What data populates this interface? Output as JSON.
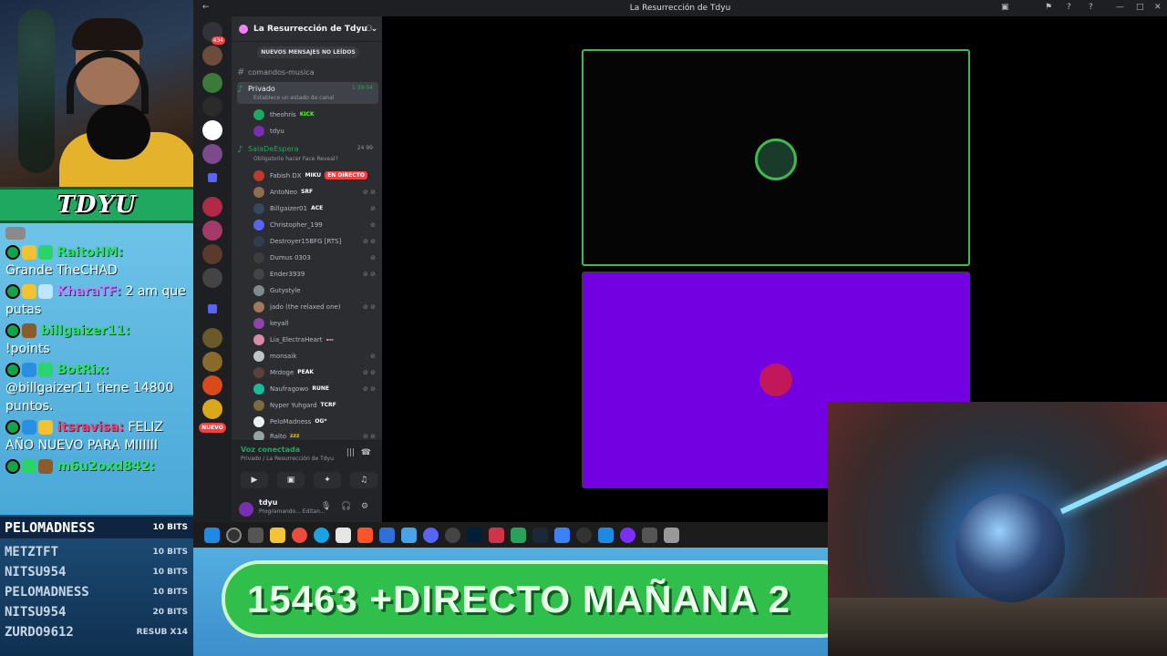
{
  "overlay": {
    "streamer_name": "TDYU",
    "chat": [
      {
        "user": "RaitoHM:",
        "user_color": "#2ee05b",
        "text": "Grande TheCHAD",
        "badges": [
          "mod",
          "crown",
          "gg"
        ]
      },
      {
        "user": "KharaTF:",
        "user_color": "#c77dff",
        "text": "2 am que putas",
        "badges": [
          "mod",
          "crown",
          "ice"
        ]
      },
      {
        "user": "billgaizer11:",
        "user_color": "#2ee05b",
        "text": "!points",
        "badges": [
          "mod",
          "gift"
        ]
      },
      {
        "user": "BotRix:",
        "user_color": "#2ee05b",
        "text": "@billgaizer11 tiene 14800 puntos.",
        "badges": [
          "mod",
          "sword",
          "bot"
        ]
      },
      {
        "user": "itsravisa:",
        "user_color": "#ff3b6b",
        "text": "FELIZ AÑO NUEVO PARA MIIIIII",
        "badges": [
          "mod",
          "sword",
          "crown"
        ]
      },
      {
        "user": "m6u2oxd842:",
        "user_color": "#2ee05b",
        "text": "",
        "badges": [
          "mod",
          "gg",
          "gift"
        ]
      }
    ],
    "bits": [
      {
        "name": "PELOMADNESS",
        "value": "10 BITS"
      },
      {
        "name": "METZTFT",
        "value": "10 BITS"
      },
      {
        "name": "NITSU954",
        "value": "10 BITS"
      },
      {
        "name": "PELOMADNESS",
        "value": "10 BITS"
      },
      {
        "name": "NITSU954",
        "value": "20 BITS"
      },
      {
        "name": "ZURDO9612",
        "value": "RESUB X14"
      }
    ],
    "ticker": "15463  +DIRECTO MAÑANA   2"
  },
  "discord": {
    "window_title": "La Resurrección de Tdyu",
    "server_name": "La Resurrección de Tdyu",
    "new_messages": "NUEVOS MENSAJES NO LEÍDOS",
    "home_badge": "434",
    "new_label": "NUEVO",
    "channels": [
      {
        "name": "comandos-musica",
        "type": "text"
      },
      {
        "name": "Privado",
        "type": "voice",
        "time": "1:39:04",
        "status": "Establece un estado de canal"
      },
      {
        "name": "SalaDeEspera",
        "type": "voice",
        "count": "24  99",
        "status": "Obligatorio hacer Face Reveal?"
      }
    ],
    "private_users": [
      {
        "name": "theohris",
        "tag": "KICK"
      },
      {
        "name": "tdyu",
        "tag": ""
      }
    ],
    "waiting_users": [
      {
        "name": "Fabish DX",
        "tag": "MIKU",
        "live": "EN DIRECTO"
      },
      {
        "name": "AntoNeo",
        "tag": "SRF"
      },
      {
        "name": "Billgaizer01",
        "tag": "ACE"
      },
      {
        "name": "Christopher_199",
        "tag": ""
      },
      {
        "name": "Destroyer15BFG [RTS]",
        "tag": ""
      },
      {
        "name": "Dumus 0303",
        "tag": ""
      },
      {
        "name": "Ender3939",
        "tag": ""
      },
      {
        "name": "Gutystyle",
        "tag": ""
      },
      {
        "name": "jado (the relaxed one)",
        "tag": ""
      },
      {
        "name": "keyall",
        "tag": ""
      },
      {
        "name": "Lia_ElectraHeart",
        "tag": "ₐₙₑ"
      },
      {
        "name": "monsaik",
        "tag": ""
      },
      {
        "name": "Mrdoge",
        "tag": "PEAK"
      },
      {
        "name": "Naufragowo",
        "tag": "RUNE"
      },
      {
        "name": "Nyper Yuhgard",
        "tag": "TCRF"
      },
      {
        "name": "PeloMadness",
        "tag": "OG*"
      },
      {
        "name": "Raito",
        "tag": "zzz"
      }
    ],
    "voice_connected": "Voz conectada",
    "voice_location": "Privado / La Resurrección de Tdyu",
    "user": {
      "name": "tdyu",
      "status": "Programando... Editan..."
    }
  }
}
